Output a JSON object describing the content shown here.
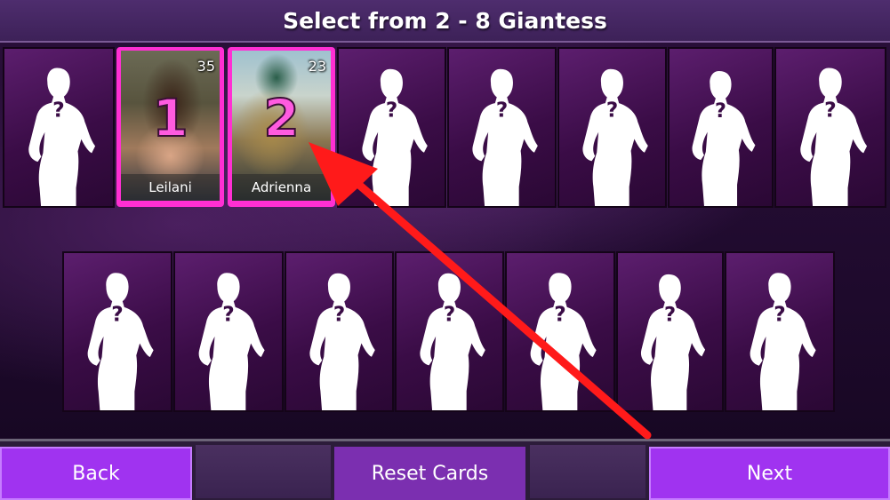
{
  "header": {
    "title": "Select from 2 - 8 Giantess"
  },
  "slots": {
    "unknown_symbol": "?",
    "selected": [
      {
        "order": "1",
        "name": "Leilani",
        "age": "35",
        "icon": "character-portrait"
      },
      {
        "order": "2",
        "name": "Adrienna",
        "age": "23",
        "icon": "character-portrait"
      }
    ]
  },
  "buttons": {
    "back_label": "Back",
    "reset_label": "Reset Cards",
    "next_label": "Next"
  },
  "colors": {
    "accent_purple": "#a033f0",
    "selected_border": "#ff2fd3",
    "arrow": "#ff1a1a"
  }
}
